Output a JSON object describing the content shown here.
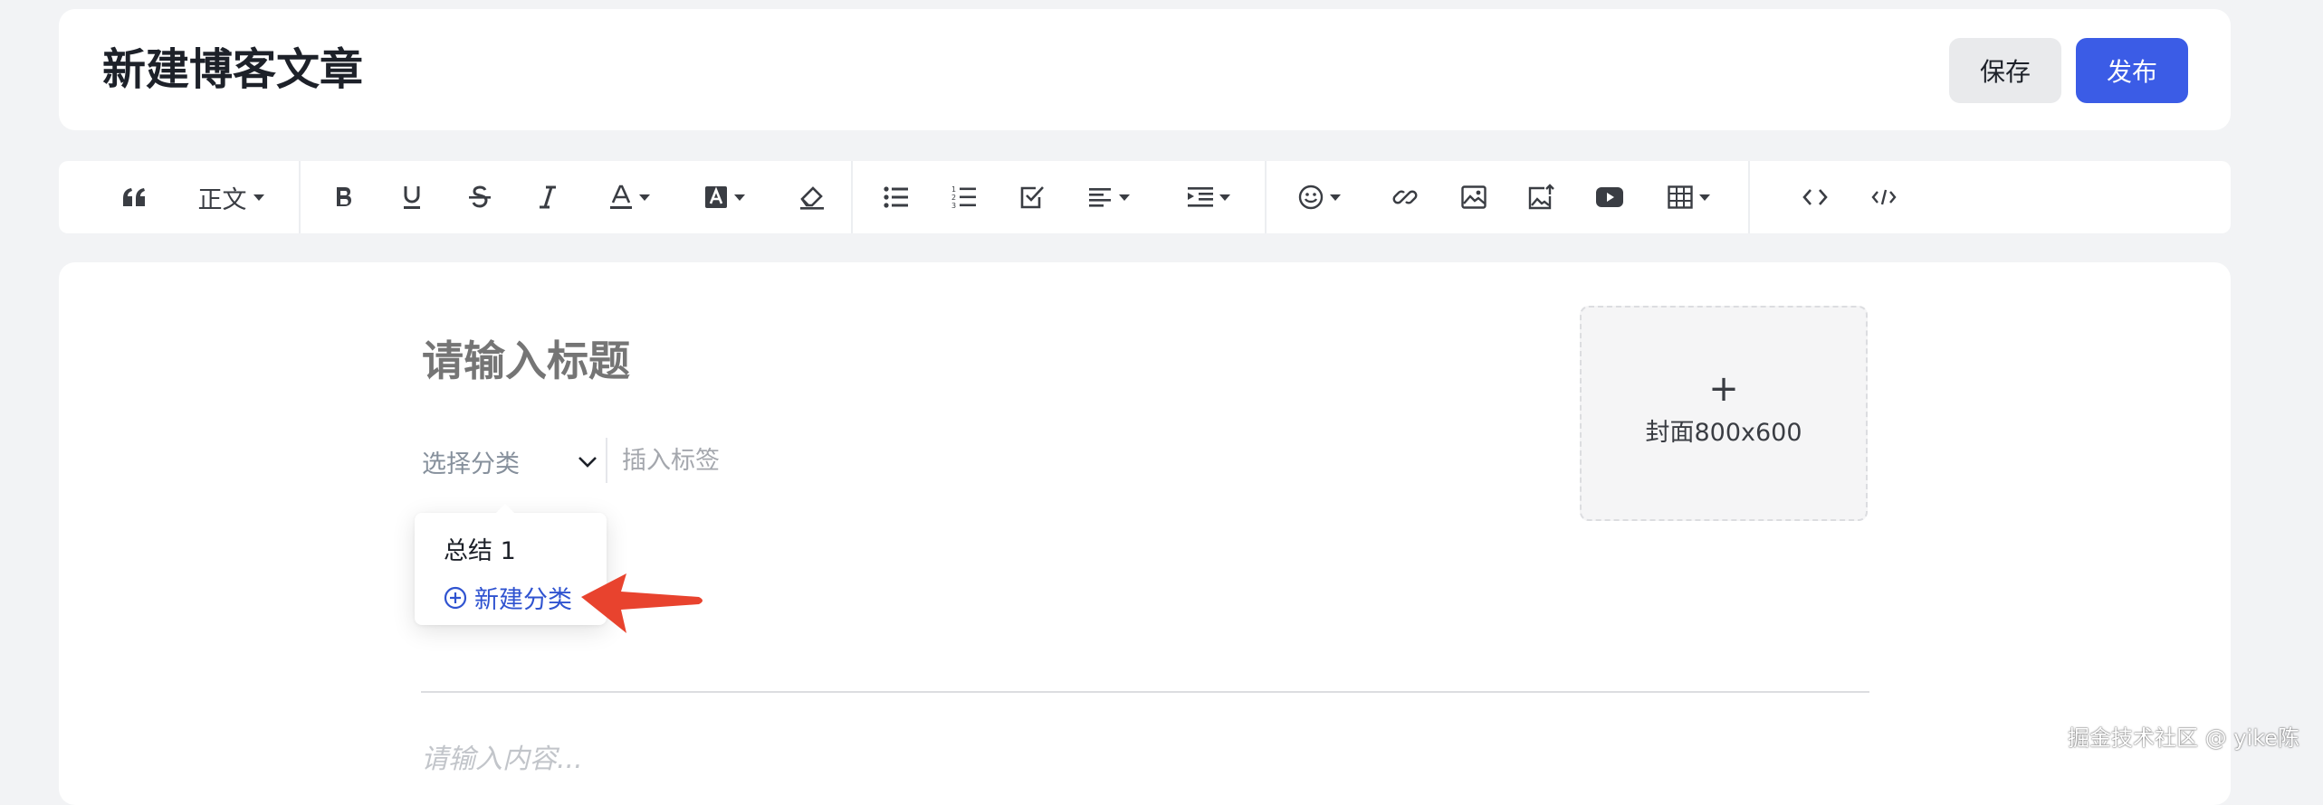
{
  "header": {
    "title": "新建博客文章",
    "save_label": "保存",
    "publish_label": "发布"
  },
  "toolbar": {
    "paragraph_label": "正文",
    "groups": [
      [
        "quote-icon",
        "paragraph-style-dropdown"
      ],
      [
        "bold-icon",
        "underline-icon",
        "strikethrough-icon",
        "italic-icon",
        "font-color-icon",
        "highlight-color-icon",
        "clear-format-icon"
      ],
      [
        "bulleted-list-icon",
        "numbered-list-icon",
        "checklist-icon",
        "align-icon",
        "indent-icon"
      ],
      [
        "emoji-icon",
        "link-icon",
        "image-icon",
        "upload-image-icon",
        "video-icon",
        "table-icon"
      ],
      [
        "code-icon",
        "code-block-icon"
      ]
    ]
  },
  "editor": {
    "title_placeholder": "请输入标题",
    "category_placeholder": "选择分类",
    "tag_placeholder": "插入标签",
    "cover_label": "封面800x600",
    "content_placeholder": "请输入内容..."
  },
  "dropdown": {
    "items": [
      "总结 1"
    ],
    "new_category_label": "新建分类"
  },
  "colors": {
    "accent": "#3b5ce6",
    "link": "#2f53d0",
    "annotation_arrow": "#e8432e"
  },
  "watermark": "掘金技术社区 @ yike陈"
}
